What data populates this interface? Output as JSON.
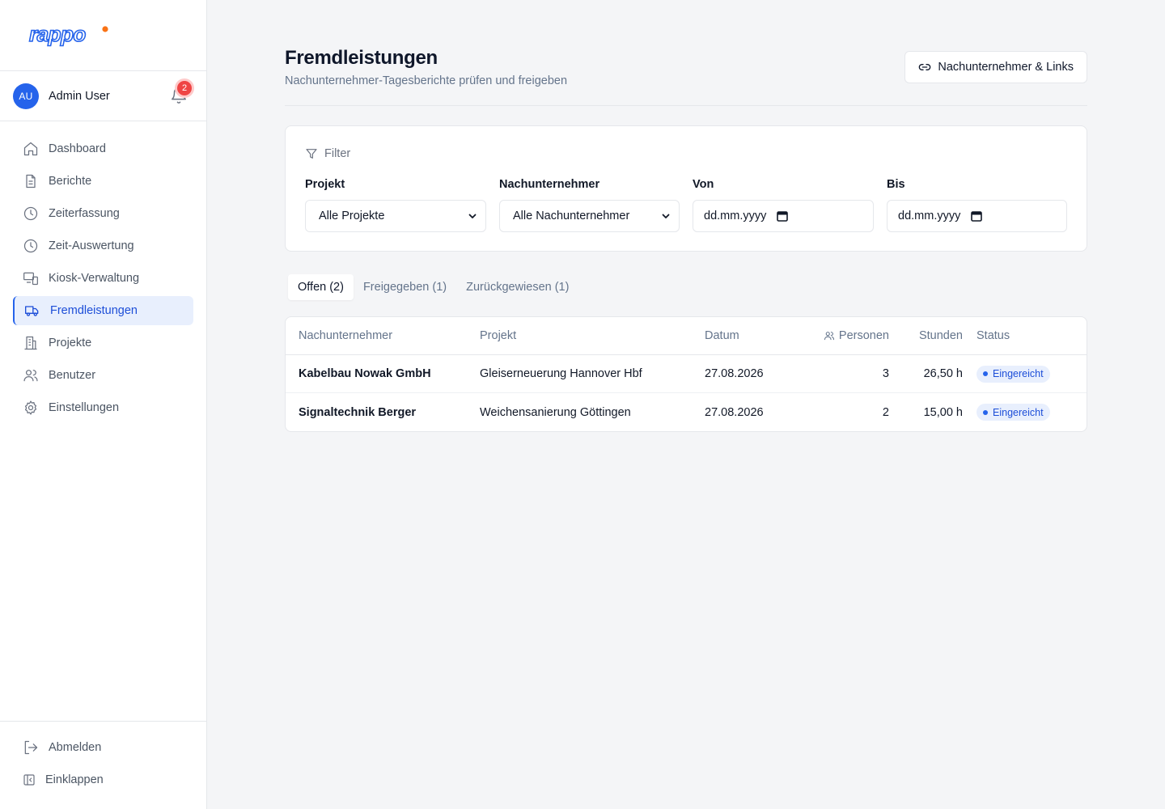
{
  "brand": {
    "logo_text": "rappo",
    "accent": "#f97316",
    "primary": "#2563eb"
  },
  "user": {
    "initials": "AU",
    "name": "Admin User",
    "notifications": "2"
  },
  "nav": {
    "items": [
      {
        "label": "Dashboard",
        "icon": "home-icon"
      },
      {
        "label": "Berichte",
        "icon": "file-icon"
      },
      {
        "label": "Zeiterfassung",
        "icon": "clock-icon"
      },
      {
        "label": "Zeit-Auswertung",
        "icon": "clock-icon"
      },
      {
        "label": "Kiosk-Verwaltung",
        "icon": "devices-icon"
      },
      {
        "label": "Fremdleistungen",
        "icon": "truck-icon",
        "active": true
      },
      {
        "label": "Projekte",
        "icon": "building-icon"
      },
      {
        "label": "Benutzer",
        "icon": "users-icon"
      },
      {
        "label": "Einstellungen",
        "icon": "gear-icon"
      }
    ],
    "logout": "Abmelden",
    "collapse": "Einklappen"
  },
  "header": {
    "title": "Fremdleistungen",
    "subtitle": "Nachunternehmer-Tagesberichte prüfen und freigeben",
    "links_button": "Nachunternehmer & Links"
  },
  "filter": {
    "title": "Filter",
    "project": {
      "label": "Projekt",
      "value": "Alle Projekte"
    },
    "subcontractor": {
      "label": "Nachunternehmer",
      "value": "Alle Nachunternehmer"
    },
    "from": {
      "label": "Von",
      "placeholder": "dd.mm.yyyy"
    },
    "to": {
      "label": "Bis",
      "placeholder": "dd.mm.yyyy"
    }
  },
  "tabs": [
    {
      "label": "Offen (2)",
      "active": true
    },
    {
      "label": "Freigegeben (1)"
    },
    {
      "label": "Zurückgewiesen (1)"
    }
  ],
  "table": {
    "headers": {
      "subcontractor": "Nachunternehmer",
      "project": "Projekt",
      "date": "Datum",
      "persons": "Personen",
      "hours": "Stunden",
      "status": "Status"
    },
    "rows": [
      {
        "subcontractor": "Kabelbau Nowak GmbH",
        "project": "Gleiserneuerung Hannover Hbf",
        "date": "27.08.2026",
        "persons": "3",
        "hours": "26,50 h",
        "status": "Eingereicht"
      },
      {
        "subcontractor": "Signaltechnik Berger",
        "project": "Weichensanierung Göttingen",
        "date": "27.08.2026",
        "persons": "2",
        "hours": "15,00 h",
        "status": "Eingereicht"
      }
    ]
  }
}
